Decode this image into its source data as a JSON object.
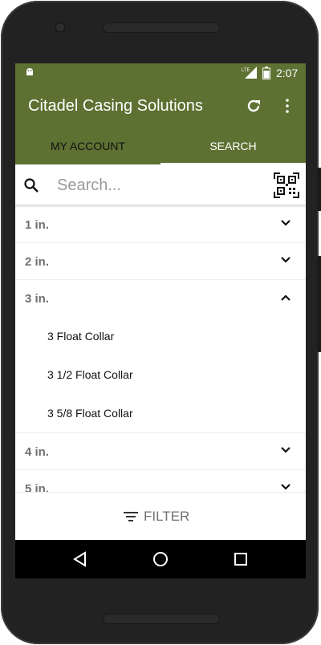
{
  "status_bar": {
    "time": "2:07",
    "network": "LTE"
  },
  "app_bar": {
    "title": "Citadel Casing Solutions",
    "refresh_icon": "refresh-icon",
    "more_icon": "more-vert-icon"
  },
  "tabs": [
    {
      "label": "MY ACCOUNT",
      "selected": false
    },
    {
      "label": "SEARCH",
      "selected": true
    }
  ],
  "search": {
    "placeholder": "Search...",
    "value": ""
  },
  "categories": [
    {
      "label": "1 in.",
      "expanded": false
    },
    {
      "label": "2 in.",
      "expanded": false
    },
    {
      "label": "3 in.",
      "expanded": true,
      "items": [
        "3 Float Collar",
        "3 1/2 Float Collar",
        "3 5/8 Float Collar"
      ]
    },
    {
      "label": "4 in.",
      "expanded": false
    },
    {
      "label": "5 in.",
      "expanded": false
    }
  ],
  "filter": {
    "label": "FILTER"
  },
  "colors": {
    "primary": "#5d7132",
    "tab_selected": "#ffffff",
    "tab_unselected": "#111111",
    "category_text": "#6f6f6f"
  }
}
